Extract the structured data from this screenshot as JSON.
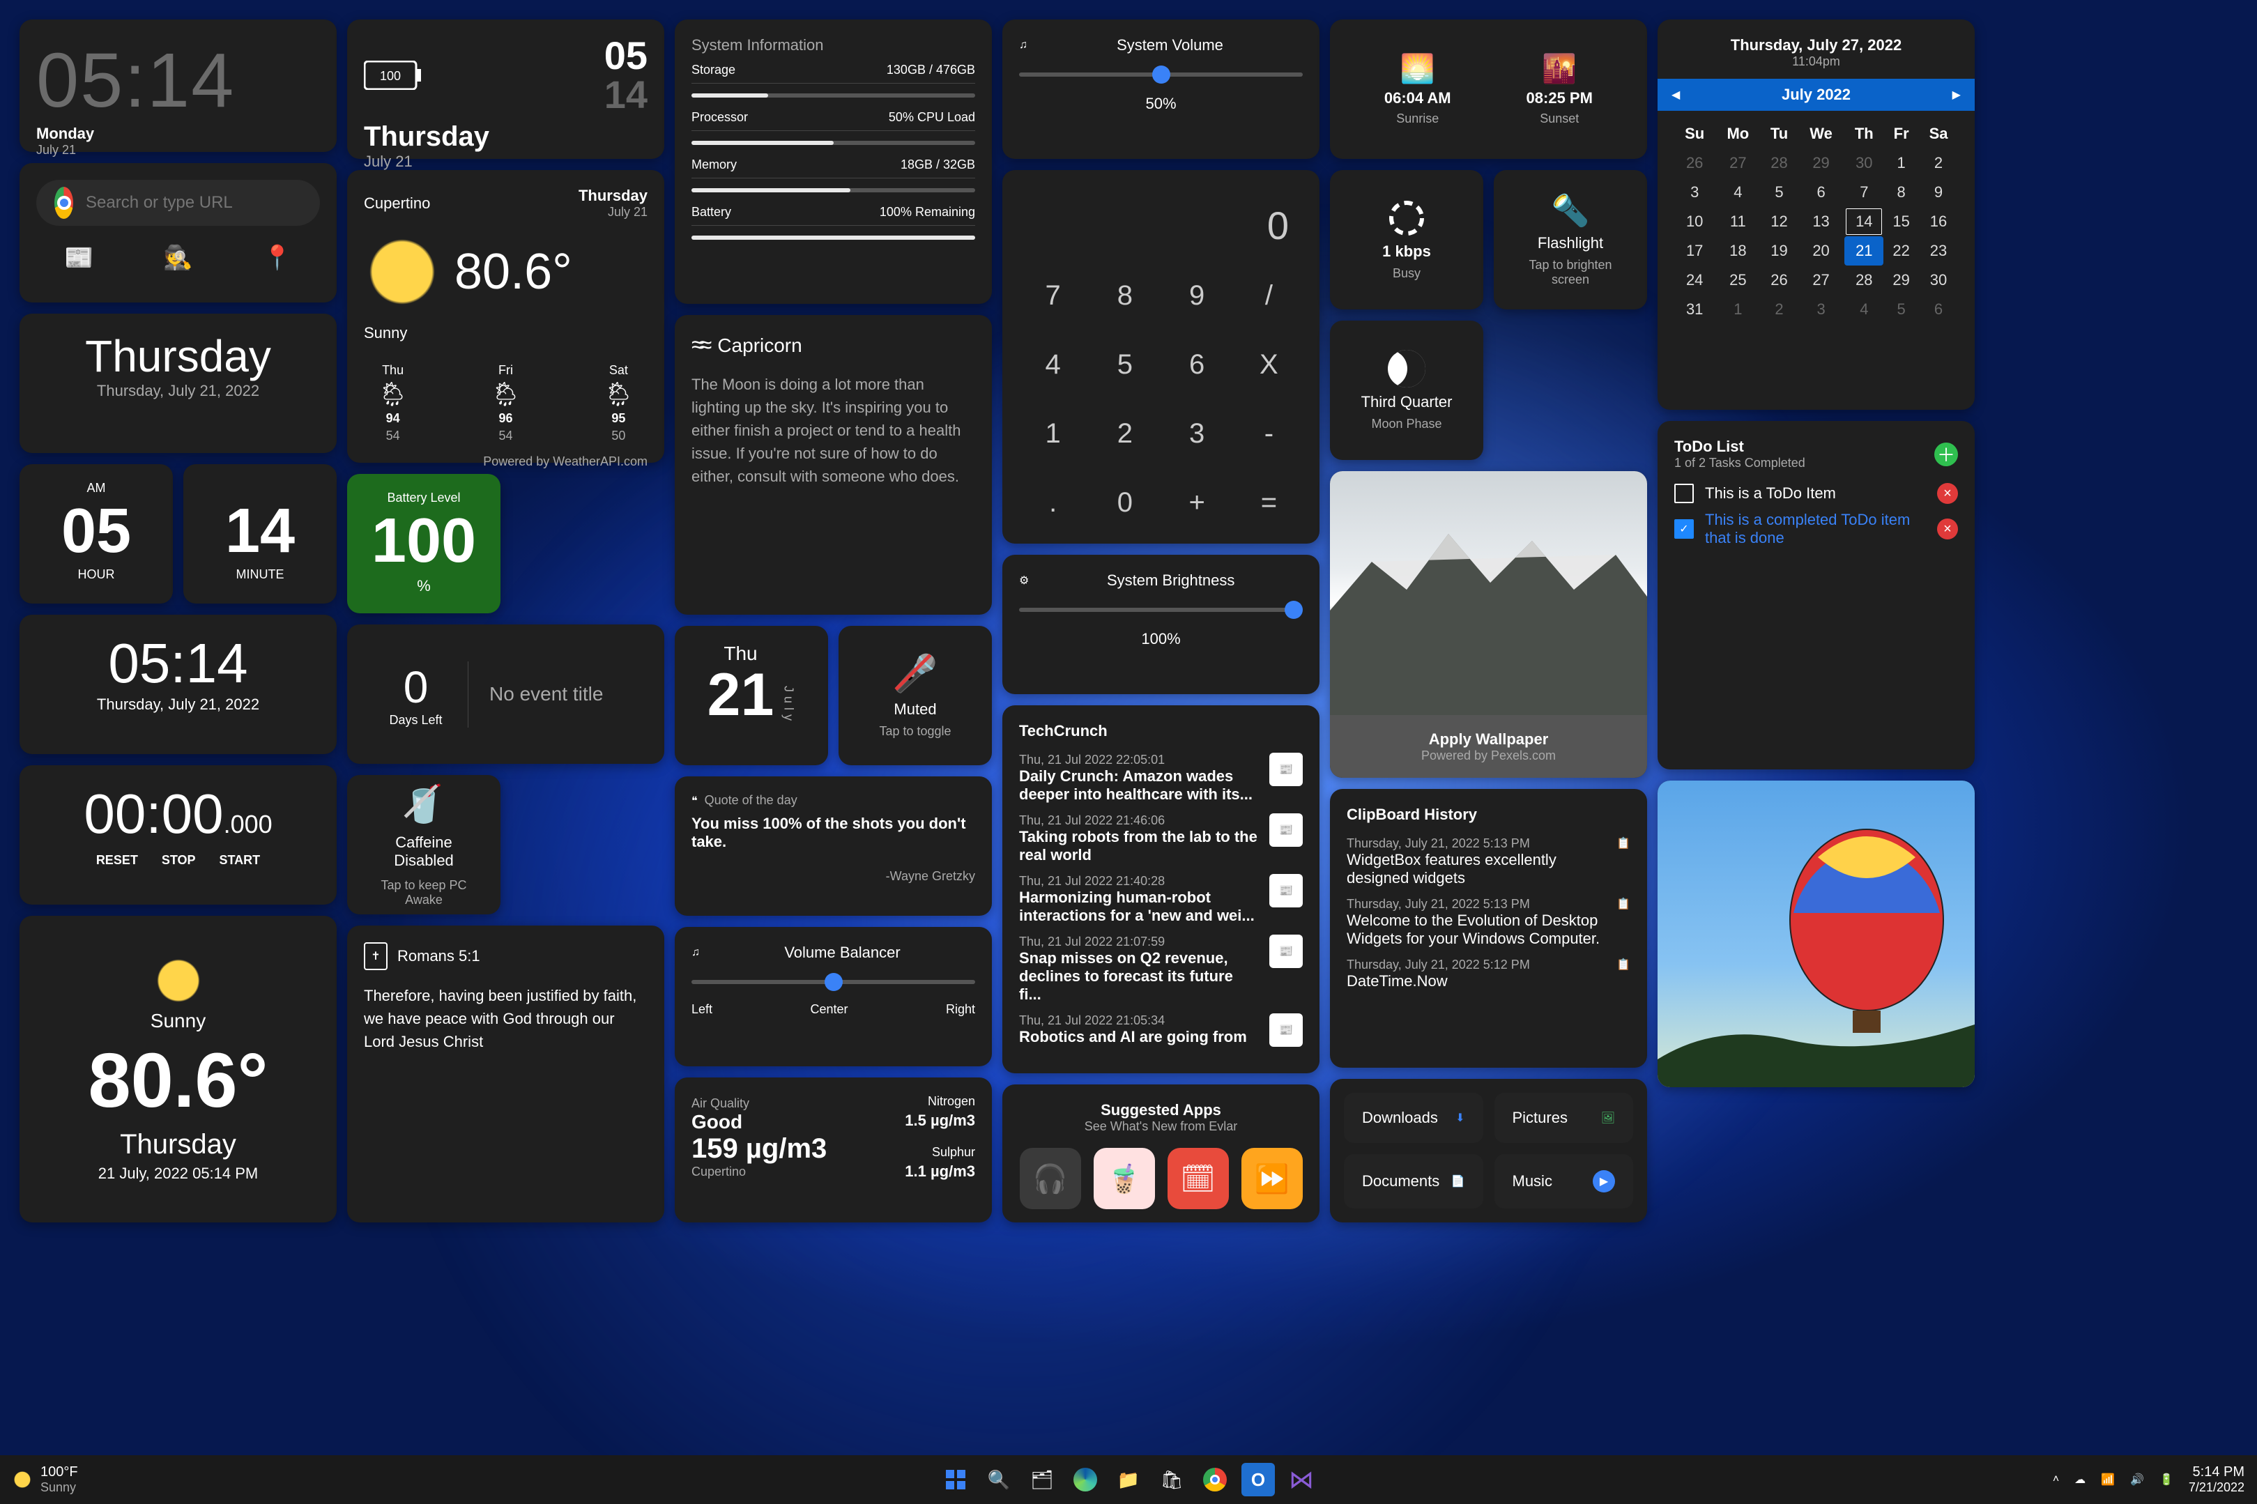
{
  "col1": {
    "clock_big": {
      "time": "05:14",
      "day": "Monday",
      "date": "July 21"
    },
    "search": {
      "placeholder": "Search or type URL"
    },
    "shortcuts": {
      "a": "news-icon",
      "b": "incognito-icon",
      "c": "pin-icon"
    },
    "day_card": {
      "day": "Thursday",
      "date": "Thursday, July 21, 2022"
    },
    "hm": {
      "am": "AM",
      "hour": "05",
      "hlabel": "HOUR",
      "min": "14",
      "mlabel": "MINUTE"
    },
    "clock2": {
      "time": "05:14",
      "date": "Thursday, July 21, 2022"
    },
    "timer": {
      "time": "00:00",
      "ms": ".000",
      "reset": "RESET",
      "stop": "STOP",
      "start": "START"
    },
    "weather": {
      "cond": "Sunny",
      "temp": "80.6°",
      "day": "Thursday",
      "stamp": "21 July, 2022 05:14 PM"
    }
  },
  "col2": {
    "top": {
      "battery_icon_level": "100",
      "date1": "05",
      "date2": "14",
      "day": "Thursday",
      "date": "July 21"
    },
    "weather": {
      "city": "Cupertino",
      "day": "Thursday",
      "daydate": "July 21",
      "cond": "Sunny",
      "temp": "80.6°",
      "credit": "Powered by WeatherAPI.com",
      "forecast": [
        {
          "d": "Thu",
          "hi": "94",
          "lo": "54"
        },
        {
          "d": "Fri",
          "hi": "96",
          "lo": "54"
        },
        {
          "d": "Sat",
          "hi": "95",
          "lo": "50"
        }
      ]
    },
    "batt_tile": {
      "label": "Battery Level",
      "value": "100",
      "pct": "%"
    },
    "event": {
      "days": "0",
      "dlabel": "Days Left",
      "title": "No event title"
    },
    "caffeine": {
      "title": "Caffeine Disabled",
      "sub": "Tap to keep PC Awake"
    },
    "verse": {
      "ref": "Romans 5:1",
      "text": "Therefore, having been justified by faith, we have peace with God through our Lord Jesus Christ"
    }
  },
  "col3": {
    "sys": {
      "title": "System Information",
      "rows": [
        {
          "label": "Storage",
          "value": "130GB / 476GB",
          "pct": 27
        },
        {
          "label": "Processor",
          "value": "50% CPU Load",
          "pct": 50
        },
        {
          "label": "Memory",
          "value": "18GB / 32GB",
          "pct": 56
        },
        {
          "label": "Battery",
          "value": "100% Remaining",
          "pct": 100
        }
      ]
    },
    "horo": {
      "sign": "Capricorn",
      "text": "The Moon is doing a lot more than lighting up the sky. It's inspiring you to either finish a project or tend to a health issue. If you're not sure of how to do either, consult with someone who does."
    },
    "datetile": {
      "dow": "Thu",
      "day": "21",
      "month": "July"
    },
    "mute": {
      "label": "Muted",
      "sub": "Tap to toggle"
    },
    "quote": {
      "title": "Quote of the day",
      "text": "You miss 100% of the shots you don't take.",
      "author": "-Wayne Gretzky"
    },
    "volbal": {
      "title": "Volume Balancer",
      "l": "Left",
      "c": "Center",
      "r": "Right"
    },
    "aqi": {
      "label": "Air Quality",
      "grade": "Good",
      "value": "159 µg/m3",
      "city": "Cupertino",
      "n_l": "Nitrogen",
      "n_v": "1.5 µg/m3",
      "s_l": "Sulphur",
      "s_v": "1.1 µg/m3"
    }
  },
  "col4": {
    "vol": {
      "title": "System Volume",
      "pct": "50%"
    },
    "calc": {
      "display": "0",
      "keys": [
        "7",
        "8",
        "9",
        "/",
        "4",
        "5",
        "6",
        "X",
        "1",
        "2",
        "3",
        "-",
        ".",
        "0",
        "+",
        "="
      ]
    },
    "bright": {
      "title": "System Brightness",
      "pct": "100%"
    },
    "news": {
      "source": "TechCrunch",
      "items": [
        {
          "t": "Thu, 21 Jul 2022 22:05:01",
          "h": "Daily Crunch: Amazon wades deeper into healthcare with its..."
        },
        {
          "t": "Thu, 21 Jul 2022 21:46:06",
          "h": "Taking robots from the lab to the real world"
        },
        {
          "t": "Thu, 21 Jul 2022 21:40:28",
          "h": "Harmonizing human-robot interactions for a 'new and wei..."
        },
        {
          "t": "Thu, 21 Jul 2022 21:07:59",
          "h": "Snap misses on Q2 revenue, declines to forecast its future fi..."
        },
        {
          "t": "Thu, 21 Jul 2022 21:05:34",
          "h": "Robotics and AI are going from"
        }
      ]
    },
    "apps": {
      "title": "Suggested Apps",
      "sub": "See What's New from Evlar"
    }
  },
  "col5": {
    "sun": {
      "rise": "06:04 AM",
      "rlabel": "Sunrise",
      "set": "08:25 PM",
      "slabel": "Sunset"
    },
    "net": {
      "value": "1 kbps",
      "label": "Busy"
    },
    "flash": {
      "title": "Flashlight",
      "sub": "Tap to brighten screen"
    },
    "moon": {
      "phase": "Third Quarter",
      "label": "Moon Phase"
    },
    "wall": {
      "cta": "Apply Wallpaper",
      "credit": "Powered by Pexels.com"
    },
    "clip": {
      "title": "ClipBoard History",
      "items": [
        {
          "t": "Thursday, July 21, 2022 5:13 PM",
          "h": "WidgetBox features excellently designed widgets"
        },
        {
          "t": "Thursday, July 21, 2022 5:13 PM",
          "h": "Welcome to the Evolution of Desktop Widgets for your Windows Computer."
        },
        {
          "t": "Thursday, July 21, 2022 5:12 PM",
          "h": "DateTime.Now"
        }
      ]
    },
    "folders": {
      "a": "Downloads",
      "b": "Pictures",
      "c": "Documents",
      "d": "Music"
    }
  },
  "col6": {
    "calhdr": {
      "date": "Thursday, July 27, 2022",
      "time": "11:04pm",
      "month": "July 2022"
    },
    "cal": {
      "dow": [
        "Su",
        "Mo",
        "Tu",
        "We",
        "Th",
        "Fr",
        "Sa"
      ],
      "weeks": [
        [
          {
            "n": "26",
            "dim": 1
          },
          {
            "n": "27",
            "dim": 1
          },
          {
            "n": "28",
            "dim": 1
          },
          {
            "n": "29",
            "dim": 1
          },
          {
            "n": "30",
            "dim": 1
          },
          {
            "n": "1"
          },
          {
            "n": "2"
          }
        ],
        [
          {
            "n": "3"
          },
          {
            "n": "4"
          },
          {
            "n": "5"
          },
          {
            "n": "6"
          },
          {
            "n": "7"
          },
          {
            "n": "8"
          },
          {
            "n": "9"
          }
        ],
        [
          {
            "n": "10"
          },
          {
            "n": "11"
          },
          {
            "n": "12"
          },
          {
            "n": "13"
          },
          {
            "n": "14",
            "hilite": 1
          },
          {
            "n": "15"
          },
          {
            "n": "16"
          }
        ],
        [
          {
            "n": "17"
          },
          {
            "n": "18"
          },
          {
            "n": "19"
          },
          {
            "n": "20"
          },
          {
            "n": "21",
            "today": 1
          },
          {
            "n": "22"
          },
          {
            "n": "23"
          }
        ],
        [
          {
            "n": "24"
          },
          {
            "n": "25"
          },
          {
            "n": "26"
          },
          {
            "n": "27"
          },
          {
            "n": "28"
          },
          {
            "n": "29"
          },
          {
            "n": "30"
          }
        ],
        [
          {
            "n": "31"
          },
          {
            "n": "1",
            "dim": 1
          },
          {
            "n": "2",
            "dim": 1
          },
          {
            "n": "3",
            "dim": 1
          },
          {
            "n": "4",
            "dim": 1
          },
          {
            "n": "5",
            "dim": 1
          },
          {
            "n": "6",
            "dim": 1
          }
        ]
      ]
    },
    "todo": {
      "title": "ToDo List",
      "sub": "1 of 2 Tasks Completed",
      "items": [
        {
          "done": false,
          "text": "This is a ToDo Item"
        },
        {
          "done": true,
          "text": "This is a completed ToDo item that is done"
        }
      ]
    }
  },
  "taskbar": {
    "weather_temp": "100°F",
    "weather_cond": "Sunny",
    "time": "5:14 PM",
    "date": "7/21/2022"
  }
}
